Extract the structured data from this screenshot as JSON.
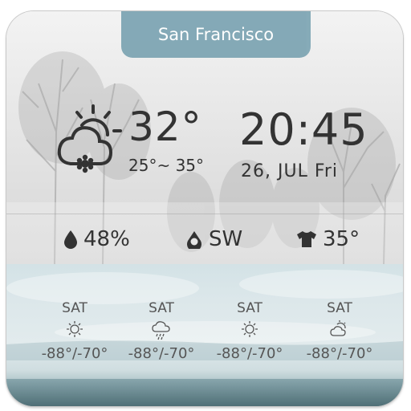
{
  "location": "San Francisco",
  "current": {
    "icon": "partly-cloudy-snow-icon",
    "temperature": "32°",
    "range": "25°~ 35°"
  },
  "clock": {
    "time": "20:45",
    "date": "26,  JUL Fri"
  },
  "stats": {
    "humidity": "48%",
    "wind": "SW",
    "feels_like": "35°"
  },
  "forecast": [
    {
      "day": "SAT",
      "icon": "sun-icon",
      "temp": "-88°/-70°"
    },
    {
      "day": "SAT",
      "icon": "rain-cloud-icon",
      "temp": "-88°/-70°"
    },
    {
      "day": "SAT",
      "icon": "sun-icon",
      "temp": "-88°/-70°"
    },
    {
      "day": "SAT",
      "icon": "partly-cloudy-icon",
      "temp": "-88°/-70°"
    }
  ],
  "colors": {
    "tab": "#7fa6b4",
    "text_dark": "#333333",
    "text_forecast": "#555555"
  }
}
